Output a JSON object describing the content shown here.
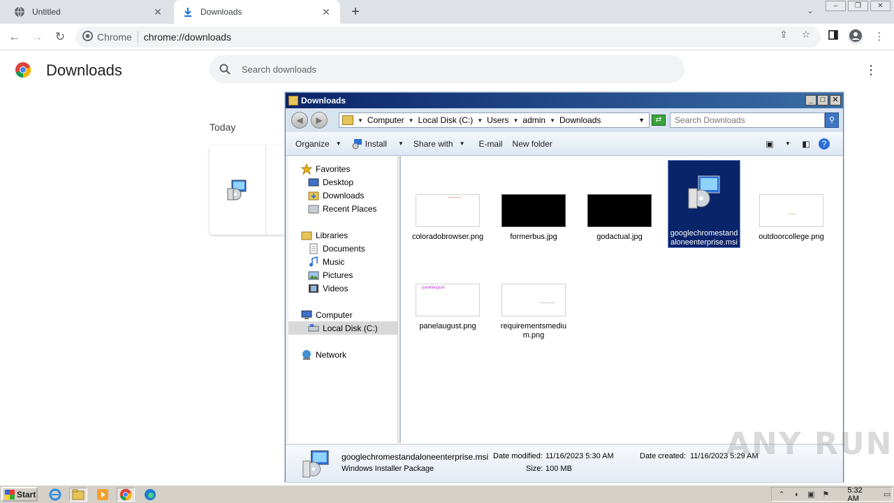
{
  "browser": {
    "tabs": [
      {
        "title": "Untitled"
      },
      {
        "title": "Downloads"
      }
    ],
    "omnibox": {
      "site": "Chrome",
      "url": "chrome://downloads"
    }
  },
  "downloads_page": {
    "title": "Downloads",
    "search_placeholder": "Search downloads",
    "today_label": "Today"
  },
  "explorer": {
    "title": "Downloads",
    "breadcrumb": [
      "Computer",
      "Local Disk (C:)",
      "Users",
      "admin",
      "Downloads"
    ],
    "search_placeholder": "Search Downloads",
    "commands": {
      "organize": "Organize",
      "install": "Install",
      "share_with": "Share with",
      "email": "E-mail",
      "new_folder": "New folder"
    },
    "nav": {
      "favorites": "Favorites",
      "desktop": "Desktop",
      "downloads": "Downloads",
      "recent_places": "Recent Places",
      "libraries": "Libraries",
      "documents": "Documents",
      "music": "Music",
      "pictures": "Pictures",
      "videos": "Videos",
      "computer": "Computer",
      "local_disk": "Local Disk (C:)",
      "network": "Network"
    },
    "files": [
      {
        "name": "coloradobrowser.png"
      },
      {
        "name": "formerbus.jpg"
      },
      {
        "name": "godactual.jpg"
      },
      {
        "name": "googlechromestandaloneenterprise.msi"
      },
      {
        "name": "outdoorcollege.png"
      },
      {
        "name": "panelaugust.png",
        "thumb_text": "panelaugust"
      },
      {
        "name": "requirementsmedium.png"
      }
    ],
    "status": {
      "filename": "googlechromestandaloneenterprise.msi",
      "type": "Windows Installer Package",
      "date_modified_label": "Date modified:",
      "date_modified": "11/16/2023 5:30 AM",
      "size_label": "Size:",
      "size": "100 MB",
      "date_created_label": "Date created:",
      "date_created": "11/16/2023 5:29 AM"
    }
  },
  "watermark": "ANY RUN",
  "taskbar": {
    "start_label": "Start",
    "clock": "5:32 AM"
  }
}
